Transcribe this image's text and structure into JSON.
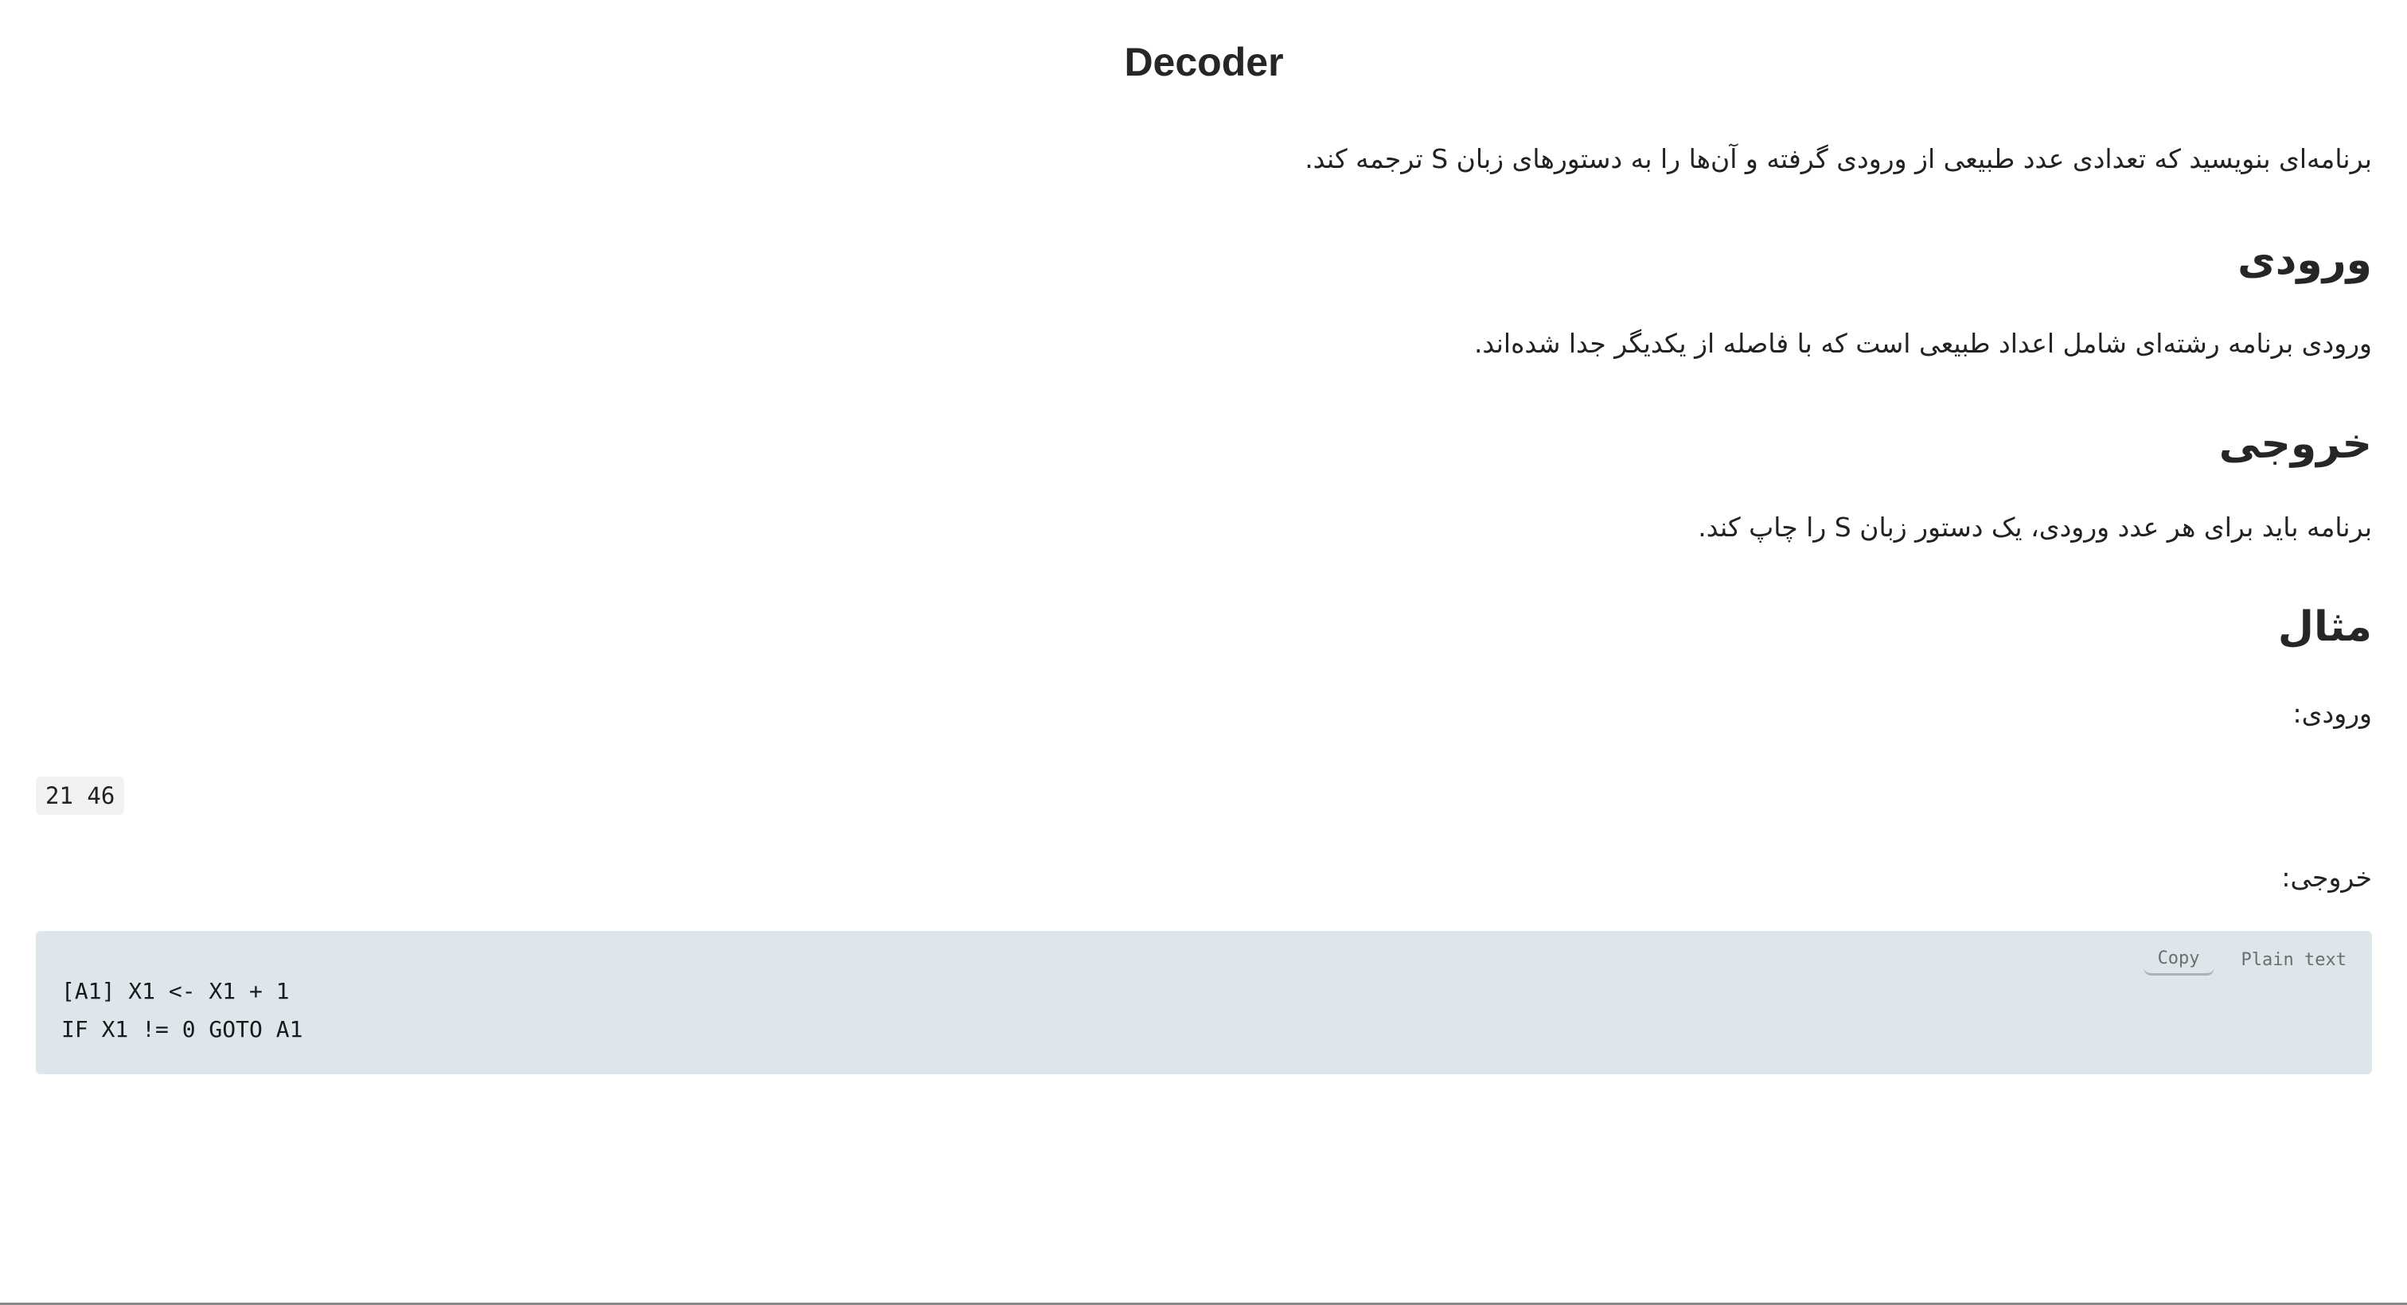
{
  "page": {
    "title": "Decoder"
  },
  "content": {
    "intro": "برنامه‌ای بنویسید که تعدادی عدد طبیعی از ورودی گرفته و آن‌ها را به دستورهای زبان S ترجمه کند.",
    "input_heading": "ورودی",
    "input_text": "ورودی برنامه رشته‌ای شامل اعداد طبیعی است که با فاصله از یکدیگر جدا شده‌اند.",
    "output_heading": "خروجی",
    "output_text": "برنامه باید برای هر عدد ورودی، یک دستور زبان S را چاپ کند.",
    "example_heading": "مثال"
  },
  "example": {
    "input_label": "ورودی:",
    "input_value": "21 46",
    "output_label": "خروجی:",
    "code": {
      "lines": [
        "[A1] X1 <- X1 + 1",
        "IF X1 != 0 GOTO A1"
      ],
      "copy_label": "Copy",
      "language_label": "Plain text"
    }
  },
  "colors": {
    "code_background": "#dde7eb",
    "inline_code_background": "#f2f2f2",
    "text": "#222222"
  }
}
